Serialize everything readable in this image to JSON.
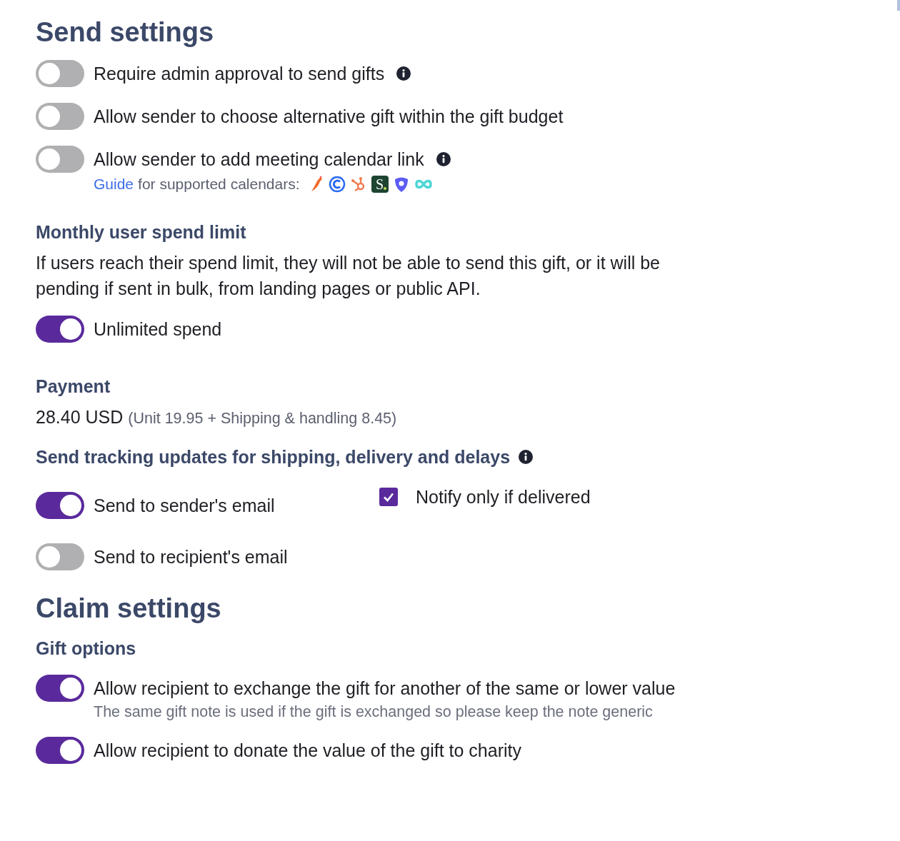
{
  "send_settings": {
    "title": "Send settings",
    "toggles": [
      {
        "label": "Require admin approval to send gifts",
        "on": false,
        "info": true
      },
      {
        "label": "Allow sender to choose alternative gift within the gift budget",
        "on": false,
        "info": false
      },
      {
        "label": "Allow sender to add meeting calendar link",
        "on": false,
        "info": true
      }
    ],
    "guide": {
      "link": "Guide",
      "text": "for supported calendars:",
      "logo_letter": "S"
    }
  },
  "spend_limit": {
    "title": "Monthly user spend limit",
    "description": "If users reach their spend limit, they will not be able to send this gift, or it will be pending if sent in bulk, from landing pages or public API.",
    "toggle": {
      "label": "Unlimited spend",
      "on": true
    }
  },
  "payment": {
    "title": "Payment",
    "amount": "28.40 USD",
    "breakdown": "(Unit 19.95 + Shipping & handling 8.45)"
  },
  "tracking": {
    "title": "Send tracking updates for shipping, delivery and delays",
    "info": true,
    "sender_toggle": {
      "label": "Send to sender's email",
      "on": true
    },
    "notify_checkbox": {
      "label": "Notify only if delivered",
      "checked": true
    },
    "recipient_toggle": {
      "label": "Send to recipient's email",
      "on": false
    }
  },
  "claim_settings": {
    "title": "Claim settings",
    "subtitle": "Gift options",
    "toggles": [
      {
        "label": "Allow recipient to exchange the gift for another of the same or lower value",
        "on": true,
        "note": "The same gift note is used if the gift is exchanged so please keep the note generic"
      },
      {
        "label": "Allow recipient to donate the value of the gift to charity",
        "on": true
      }
    ]
  }
}
